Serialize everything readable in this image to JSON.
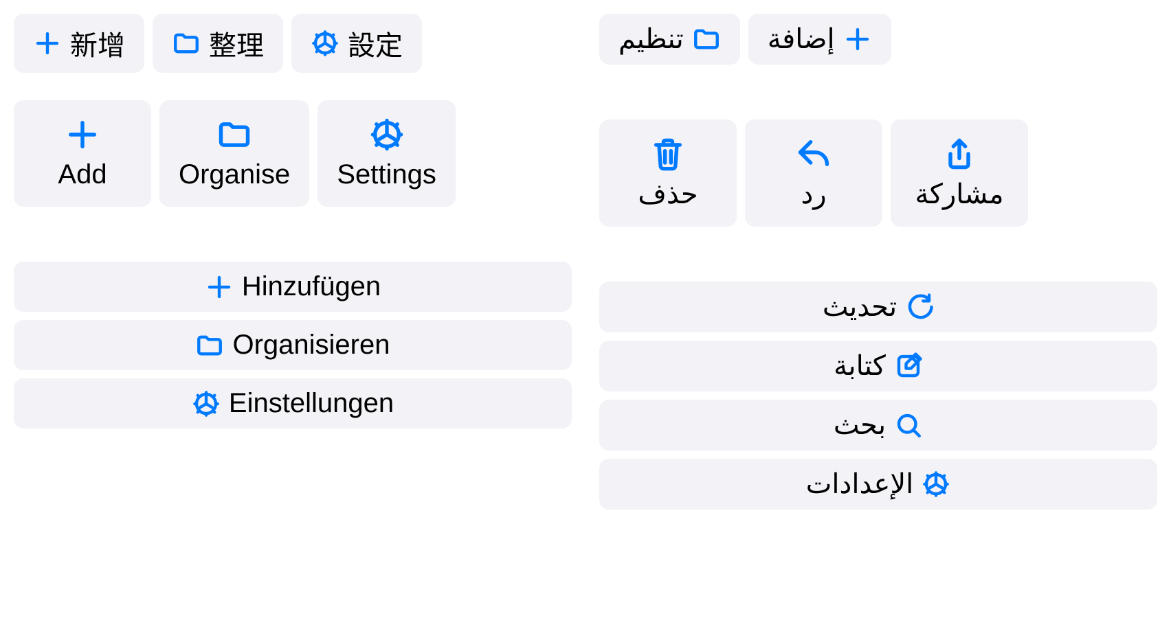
{
  "chinese": {
    "add": "新增",
    "organise": "整理",
    "settings": "設定"
  },
  "english": {
    "add": "Add",
    "organise": "Organise",
    "settings": "Settings"
  },
  "german": {
    "add": "Hinzufügen",
    "organise": "Organisieren",
    "settings": "Einstellungen"
  },
  "arabic_top": {
    "add": "إضافة",
    "organise": "تنظيم"
  },
  "arabic_mid": {
    "share": "مشاركة",
    "reply": "رد",
    "delete": "حذف"
  },
  "arabic_list": {
    "refresh": "تحديث",
    "compose": "كتابة",
    "search": "بحث",
    "settings": "الإعدادات"
  }
}
